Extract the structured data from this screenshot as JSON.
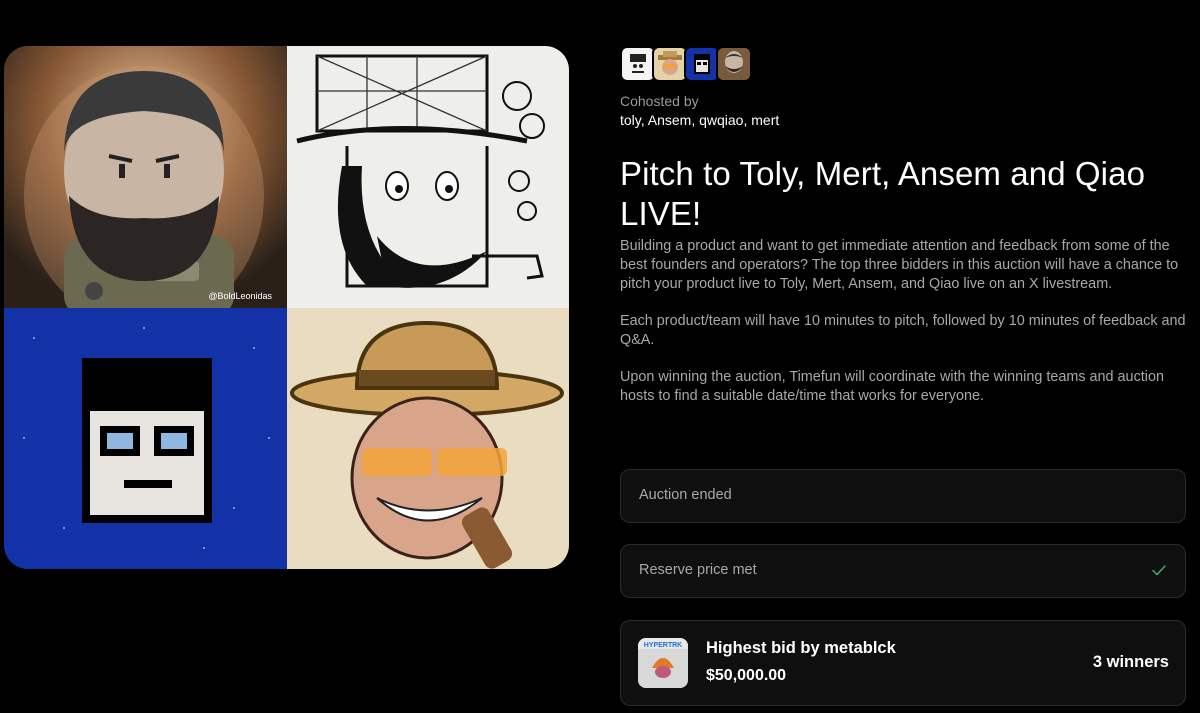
{
  "cohosts": {
    "label": "Cohosted by",
    "names": "toly, Ansem, qwqiao, mert",
    "avatars": [
      "toly-avatar",
      "ansem-avatar",
      "qwqiao-avatar",
      "mert-avatar"
    ]
  },
  "event": {
    "title": "Pitch to Toly, Mert, Ansem and Qiao LIVE!",
    "description": [
      "Building a product and want to get immediate attention and feedback from some of the best founders and operators?  The top three bidders in this auction will have a chance to pitch your product live to Toly, Mert, Ansem, and Qiao live on an X livestream.",
      "Each product/team will have 10 minutes to pitch, followed by 10 minutes of feedback and Q&A.",
      "Upon winning the auction, Timefun will coordinate with the winning teams and auction hosts to find a suitable date/time that works for everyone."
    ]
  },
  "artwork": {
    "watermark": "@BoldLeonidas"
  },
  "status": {
    "auction": "Auction ended",
    "reserve": "Reserve price met",
    "reserve_icon": "check-icon"
  },
  "bid": {
    "title": "Highest bid by metablck",
    "amount": "$50,000.00",
    "winners": "3 winners",
    "thumb_text": "HYPERTRK"
  },
  "colors": {
    "background": "#000000",
    "muted_text": "#a8a8a8",
    "box_border": "#2c2c2c",
    "check": "#3fae6a"
  }
}
